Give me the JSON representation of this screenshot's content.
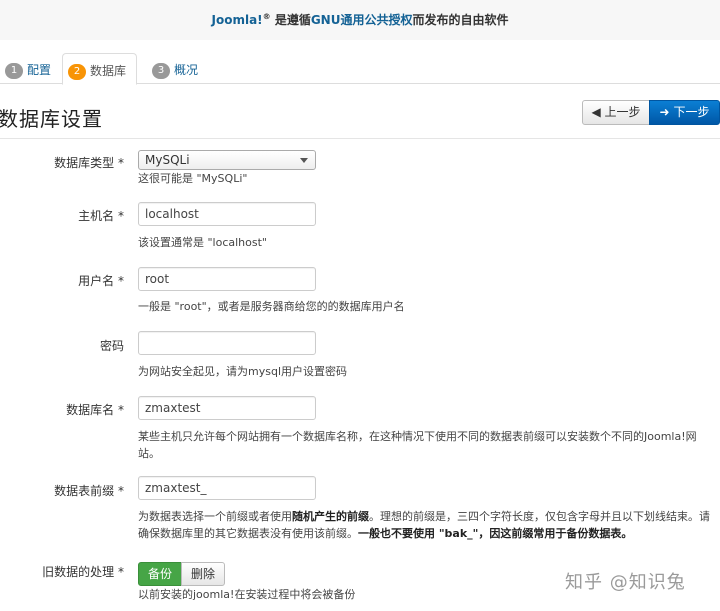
{
  "header": {
    "brand": "Joomla!",
    "reg": "®",
    "text_1": " 是遵循",
    "license": "GNU通用公共授权",
    "text_2": "而发布的自由软件"
  },
  "tabs": [
    {
      "num": "1",
      "label": "配置"
    },
    {
      "num": "2",
      "label": "数据库"
    },
    {
      "num": "3",
      "label": "概况"
    }
  ],
  "page_title": "数据库设置",
  "nav": {
    "prev_label": "上一步",
    "next_label": "下一步"
  },
  "fields": {
    "db_type": {
      "label": "数据库类型 *",
      "value": "MySQLi",
      "help": "这很可能是 \"MySQLi\""
    },
    "host": {
      "label": "主机名 *",
      "value": "localhost",
      "help": "该设置通常是 \"localhost\""
    },
    "user": {
      "label": "用户名 *",
      "value": "root",
      "help": "一般是 \"root\"，或者是服务器商给您的的数据库用户名"
    },
    "password": {
      "label": "密码",
      "value": "",
      "help": "为网站安全起见，请为mysql用户设置密码"
    },
    "db_name": {
      "label": "数据库名 *",
      "value": "zmaxtest",
      "help": "某些主机只允许每个网站拥有一个数据库名称，在这种情况下使用不同的数据表前缀可以安装数个不同的Joomla!网站。"
    },
    "prefix": {
      "label": "数据表前缀 *",
      "value": "zmaxtest_",
      "help_1": "为数据表选择一个前缀或者使用",
      "help_bold_1": "随机产生的前缀",
      "help_2": "。理想的前缀是，三四个字符长度，仅包含字母并且以下划线结束。请确保数据库里的其它数据表没有使用该前缀。",
      "help_bold_2": "一般也不要使用 \"bak_\"，因这前缀常用于备份数据表。"
    },
    "old_data": {
      "label": "旧数据的处理 *",
      "option_on": "备份",
      "option_off": "删除",
      "help": "以前安装的joomla!在安装过程中将会被备份"
    }
  },
  "watermark": "知乎 @知识兔"
}
